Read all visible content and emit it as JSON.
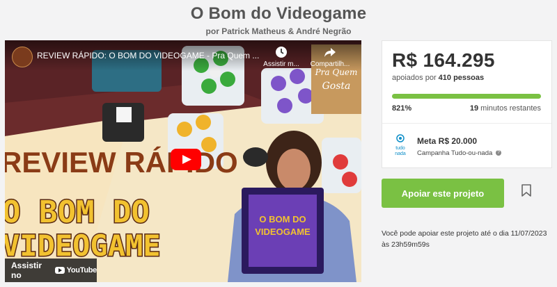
{
  "page": {
    "title": "O Bom do Videogame",
    "byline": "por Patrick Matheus & André Negrão"
  },
  "video": {
    "title": "REVIEW RÁPIDO: O BOM DO VIDEOGAME - Pra Quem ...",
    "watch_later_label": "Assistir m...",
    "share_label": "Compartilh...",
    "watch_on_label": "Assistir no",
    "youtube_label": "YouTube",
    "thumb_line1": "REVIEW RÁPIDO",
    "thumb_line2": "O BOM DO",
    "thumb_line3": "VIDEOGAME",
    "logo_text_1": "Pra Quem",
    "logo_text_2": "Gosta",
    "box_text_1": "O BOM DO",
    "box_text_2": "VIDEOGAME"
  },
  "stats": {
    "amount": "R$ 164.295",
    "backers_prefix": "apoiados por",
    "backers_count": "410 pessoas",
    "progress_percent": "821%",
    "progress_fraction": 1.0,
    "time_value": "19",
    "time_label": "minutos restantes",
    "goal": "Meta R$ 20.000",
    "campaign_type": "Campanha Tudo-ou-nada",
    "tudo_icon_text_1": "tudo",
    "tudo_icon_text_2": "nada"
  },
  "actions": {
    "support_label": "Apoiar este projeto",
    "deadline_text": "Você pode apoiar este projeto até o dia 11/07/2023 às 23h59m59s"
  },
  "colors": {
    "accent_green": "#7ac143",
    "youtube_red": "#ff0000",
    "tudo_blue": "#0c8ec8"
  }
}
